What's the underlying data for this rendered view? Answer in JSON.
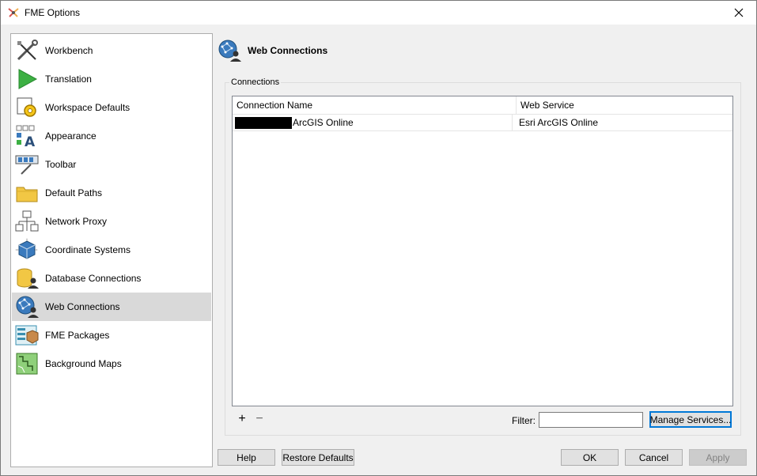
{
  "window": {
    "title": "FME Options"
  },
  "sidebar": {
    "items": [
      {
        "label": "Workbench",
        "icon": "wrench-screwdriver-icon"
      },
      {
        "label": "Translation",
        "icon": "play-triangle-icon"
      },
      {
        "label": "Workspace Defaults",
        "icon": "workspace-gear-icon"
      },
      {
        "label": "Appearance",
        "icon": "appearance-font-icon"
      },
      {
        "label": "Toolbar",
        "icon": "toolbar-icon"
      },
      {
        "label": "Default Paths",
        "icon": "folder-icon"
      },
      {
        "label": "Network Proxy",
        "icon": "network-icon"
      },
      {
        "label": "Coordinate Systems",
        "icon": "cube-axes-icon"
      },
      {
        "label": "Database Connections",
        "icon": "database-user-icon"
      },
      {
        "label": "Web Connections",
        "icon": "globe-user-icon",
        "selected": true
      },
      {
        "label": "FME Packages",
        "icon": "package-icon"
      },
      {
        "label": "Background Maps",
        "icon": "map-icon"
      }
    ]
  },
  "panel": {
    "title": "Web Connections",
    "group_label": "Connections",
    "table": {
      "columns": [
        "Connection Name",
        "Web Service"
      ],
      "rows": [
        {
          "name": "ArcGIS Online",
          "service": "Esri ArcGIS Online"
        }
      ]
    },
    "add_symbol": "+",
    "remove_symbol": "−",
    "filter_label": "Filter:",
    "filter_value": "",
    "manage_button": "Manage Services..."
  },
  "footer": {
    "help": "Help",
    "restore": "Restore Defaults",
    "ok": "OK",
    "cancel": "Cancel",
    "apply": "Apply"
  },
  "colors": {
    "selected_row": "#d9d9d9",
    "focus_border": "#0078d7",
    "button_face": "#e1e1e1"
  }
}
